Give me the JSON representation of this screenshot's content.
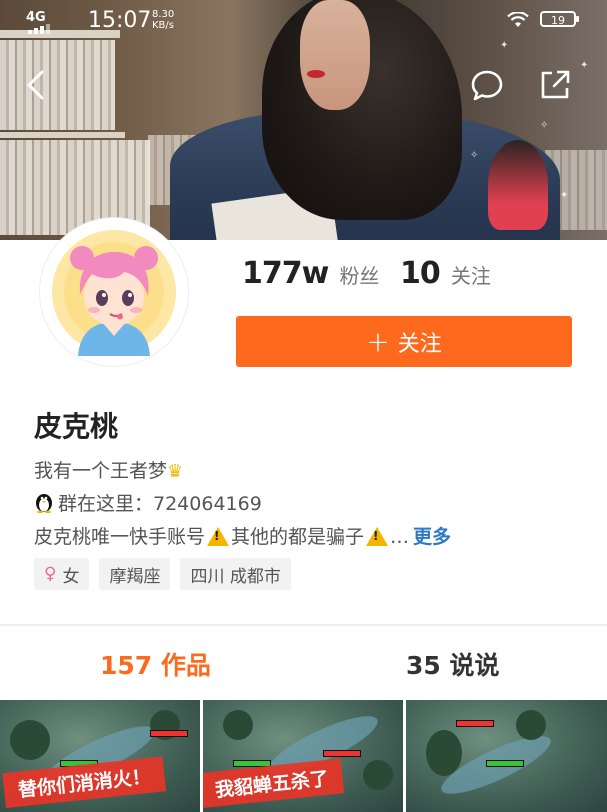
{
  "status_bar": {
    "network": "4G",
    "time": "15:07",
    "speed_value": "8.30",
    "speed_unit": "KB/s",
    "battery": "19"
  },
  "header": {
    "back_icon": "chevron-left-icon",
    "message_icon": "chat-bubble-icon",
    "share_icon": "share-icon"
  },
  "profile": {
    "followers_count": "177w",
    "followers_label": "粉丝",
    "following_count": "10",
    "following_label": "关注",
    "follow_button_label": "关注",
    "name": "皮克桃",
    "bio_line1": "我有一个王者梦",
    "bio_line2": "群在这里：724064169",
    "bio_line3_a": "皮克桃唯一快手账号",
    "bio_line3_b": "其他的都是骗子",
    "bio_more": "更多",
    "tags": [
      "女",
      "摩羯座",
      "四川 成都市"
    ]
  },
  "tabs": {
    "works": "157 作品",
    "posts": "35 说说"
  },
  "thumbnails": [
    {
      "caption": "替你们消消火！"
    },
    {
      "caption": "我貂蝉五杀了"
    },
    {
      "caption": ""
    }
  ],
  "colors": {
    "accent": "#fe6a1d",
    "link": "#2e78c8",
    "warning": "#f5b400"
  }
}
